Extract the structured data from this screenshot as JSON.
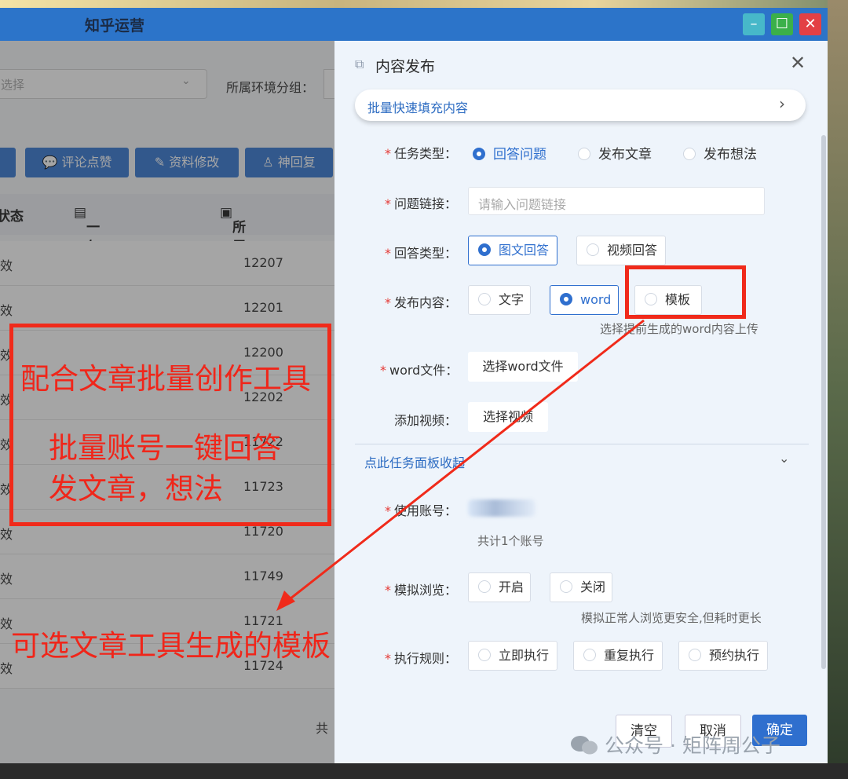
{
  "window": {
    "title": "知乎运营"
  },
  "background": {
    "select_placeholder": "选择",
    "group_label": "所属环境分组：",
    "toolbar_buttons": [
      "评论点赞",
      "资料修改",
      "神回复"
    ],
    "table_headers": [
      "状态",
      "一句话简介",
      "所属环境ID."
    ],
    "rows": [
      {
        "status": "效",
        "env_id": "12207"
      },
      {
        "status": "效",
        "env_id": "12201"
      },
      {
        "status": "效",
        "env_id": "12200"
      },
      {
        "status": "效",
        "env_id": "12202"
      },
      {
        "status": "效",
        "env_id": "11722"
      },
      {
        "status": "效",
        "env_id": "11723"
      },
      {
        "status": "效",
        "env_id": "11720"
      },
      {
        "status": "效",
        "env_id": "11749"
      },
      {
        "status": "效",
        "env_id": "11721"
      },
      {
        "status": "效",
        "env_id": "11724"
      }
    ],
    "pagination_prefix": "共"
  },
  "annotations": {
    "box_lines": [
      "配合文章批量创作工具",
      "批量账号一键回答",
      "发文章，想法"
    ],
    "bottom_note": "可选文章工具生成的模板",
    "color": "#f02a1a"
  },
  "modal": {
    "title": "内容发布",
    "quick_fill": "批量快速填充内容",
    "task_type": {
      "label": "任务类型：",
      "options": [
        "回答问题",
        "发布文章",
        "发布想法"
      ],
      "selected": "回答问题"
    },
    "question_link": {
      "label": "问题链接：",
      "placeholder": "请输入问题链接"
    },
    "answer_type": {
      "label": "回答类型：",
      "options": [
        "图文回答",
        "视频回答"
      ],
      "selected": "图文回答"
    },
    "publish_content": {
      "label": "发布内容：",
      "options": [
        "文字",
        "word",
        "模板"
      ],
      "selected": "word",
      "hint": "选择提前生成的word内容上传"
    },
    "word_file": {
      "label": "word文件：",
      "button": "选择word文件"
    },
    "add_video": {
      "label": "添加视频：",
      "button": "选择视频"
    },
    "collapse_label": "点此任务面板收起",
    "account": {
      "label": "使用账号：",
      "count": "共计1个账号"
    },
    "sim_browse": {
      "label": "模拟浏览：",
      "options": [
        "开启",
        "关闭"
      ],
      "hint": "模拟正常人浏览更安全,但耗时更长"
    },
    "exec_rule": {
      "label": "执行规则：",
      "options": [
        "立即执行",
        "重复执行",
        "预约执行"
      ]
    },
    "footer": {
      "clear": "清空",
      "cancel": "取消",
      "ok": "确定"
    },
    "accent": "#2f6fce"
  },
  "watermark": "公众号 · 矩阵周公子"
}
